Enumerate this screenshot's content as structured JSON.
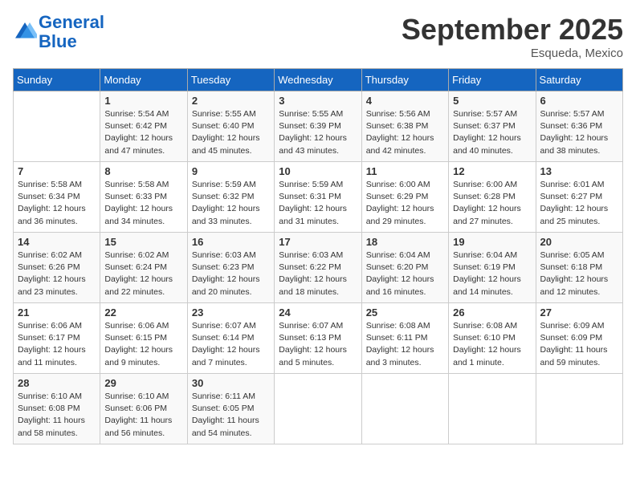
{
  "header": {
    "logo_line1": "General",
    "logo_line2": "Blue",
    "month": "September 2025",
    "location": "Esqueda, Mexico"
  },
  "weekdays": [
    "Sunday",
    "Monday",
    "Tuesday",
    "Wednesday",
    "Thursday",
    "Friday",
    "Saturday"
  ],
  "weeks": [
    [
      {
        "day": "",
        "info": ""
      },
      {
        "day": "1",
        "info": "Sunrise: 5:54 AM\nSunset: 6:42 PM\nDaylight: 12 hours\nand 47 minutes."
      },
      {
        "day": "2",
        "info": "Sunrise: 5:55 AM\nSunset: 6:40 PM\nDaylight: 12 hours\nand 45 minutes."
      },
      {
        "day": "3",
        "info": "Sunrise: 5:55 AM\nSunset: 6:39 PM\nDaylight: 12 hours\nand 43 minutes."
      },
      {
        "day": "4",
        "info": "Sunrise: 5:56 AM\nSunset: 6:38 PM\nDaylight: 12 hours\nand 42 minutes."
      },
      {
        "day": "5",
        "info": "Sunrise: 5:57 AM\nSunset: 6:37 PM\nDaylight: 12 hours\nand 40 minutes."
      },
      {
        "day": "6",
        "info": "Sunrise: 5:57 AM\nSunset: 6:36 PM\nDaylight: 12 hours\nand 38 minutes."
      }
    ],
    [
      {
        "day": "7",
        "info": "Sunrise: 5:58 AM\nSunset: 6:34 PM\nDaylight: 12 hours\nand 36 minutes."
      },
      {
        "day": "8",
        "info": "Sunrise: 5:58 AM\nSunset: 6:33 PM\nDaylight: 12 hours\nand 34 minutes."
      },
      {
        "day": "9",
        "info": "Sunrise: 5:59 AM\nSunset: 6:32 PM\nDaylight: 12 hours\nand 33 minutes."
      },
      {
        "day": "10",
        "info": "Sunrise: 5:59 AM\nSunset: 6:31 PM\nDaylight: 12 hours\nand 31 minutes."
      },
      {
        "day": "11",
        "info": "Sunrise: 6:00 AM\nSunset: 6:29 PM\nDaylight: 12 hours\nand 29 minutes."
      },
      {
        "day": "12",
        "info": "Sunrise: 6:00 AM\nSunset: 6:28 PM\nDaylight: 12 hours\nand 27 minutes."
      },
      {
        "day": "13",
        "info": "Sunrise: 6:01 AM\nSunset: 6:27 PM\nDaylight: 12 hours\nand 25 minutes."
      }
    ],
    [
      {
        "day": "14",
        "info": "Sunrise: 6:02 AM\nSunset: 6:26 PM\nDaylight: 12 hours\nand 23 minutes."
      },
      {
        "day": "15",
        "info": "Sunrise: 6:02 AM\nSunset: 6:24 PM\nDaylight: 12 hours\nand 22 minutes."
      },
      {
        "day": "16",
        "info": "Sunrise: 6:03 AM\nSunset: 6:23 PM\nDaylight: 12 hours\nand 20 minutes."
      },
      {
        "day": "17",
        "info": "Sunrise: 6:03 AM\nSunset: 6:22 PM\nDaylight: 12 hours\nand 18 minutes."
      },
      {
        "day": "18",
        "info": "Sunrise: 6:04 AM\nSunset: 6:20 PM\nDaylight: 12 hours\nand 16 minutes."
      },
      {
        "day": "19",
        "info": "Sunrise: 6:04 AM\nSunset: 6:19 PM\nDaylight: 12 hours\nand 14 minutes."
      },
      {
        "day": "20",
        "info": "Sunrise: 6:05 AM\nSunset: 6:18 PM\nDaylight: 12 hours\nand 12 minutes."
      }
    ],
    [
      {
        "day": "21",
        "info": "Sunrise: 6:06 AM\nSunset: 6:17 PM\nDaylight: 12 hours\nand 11 minutes."
      },
      {
        "day": "22",
        "info": "Sunrise: 6:06 AM\nSunset: 6:15 PM\nDaylight: 12 hours\nand 9 minutes."
      },
      {
        "day": "23",
        "info": "Sunrise: 6:07 AM\nSunset: 6:14 PM\nDaylight: 12 hours\nand 7 minutes."
      },
      {
        "day": "24",
        "info": "Sunrise: 6:07 AM\nSunset: 6:13 PM\nDaylight: 12 hours\nand 5 minutes."
      },
      {
        "day": "25",
        "info": "Sunrise: 6:08 AM\nSunset: 6:11 PM\nDaylight: 12 hours\nand 3 minutes."
      },
      {
        "day": "26",
        "info": "Sunrise: 6:08 AM\nSunset: 6:10 PM\nDaylight: 12 hours\nand 1 minute."
      },
      {
        "day": "27",
        "info": "Sunrise: 6:09 AM\nSunset: 6:09 PM\nDaylight: 11 hours\nand 59 minutes."
      }
    ],
    [
      {
        "day": "28",
        "info": "Sunrise: 6:10 AM\nSunset: 6:08 PM\nDaylight: 11 hours\nand 58 minutes."
      },
      {
        "day": "29",
        "info": "Sunrise: 6:10 AM\nSunset: 6:06 PM\nDaylight: 11 hours\nand 56 minutes."
      },
      {
        "day": "30",
        "info": "Sunrise: 6:11 AM\nSunset: 6:05 PM\nDaylight: 11 hours\nand 54 minutes."
      },
      {
        "day": "",
        "info": ""
      },
      {
        "day": "",
        "info": ""
      },
      {
        "day": "",
        "info": ""
      },
      {
        "day": "",
        "info": ""
      }
    ]
  ]
}
